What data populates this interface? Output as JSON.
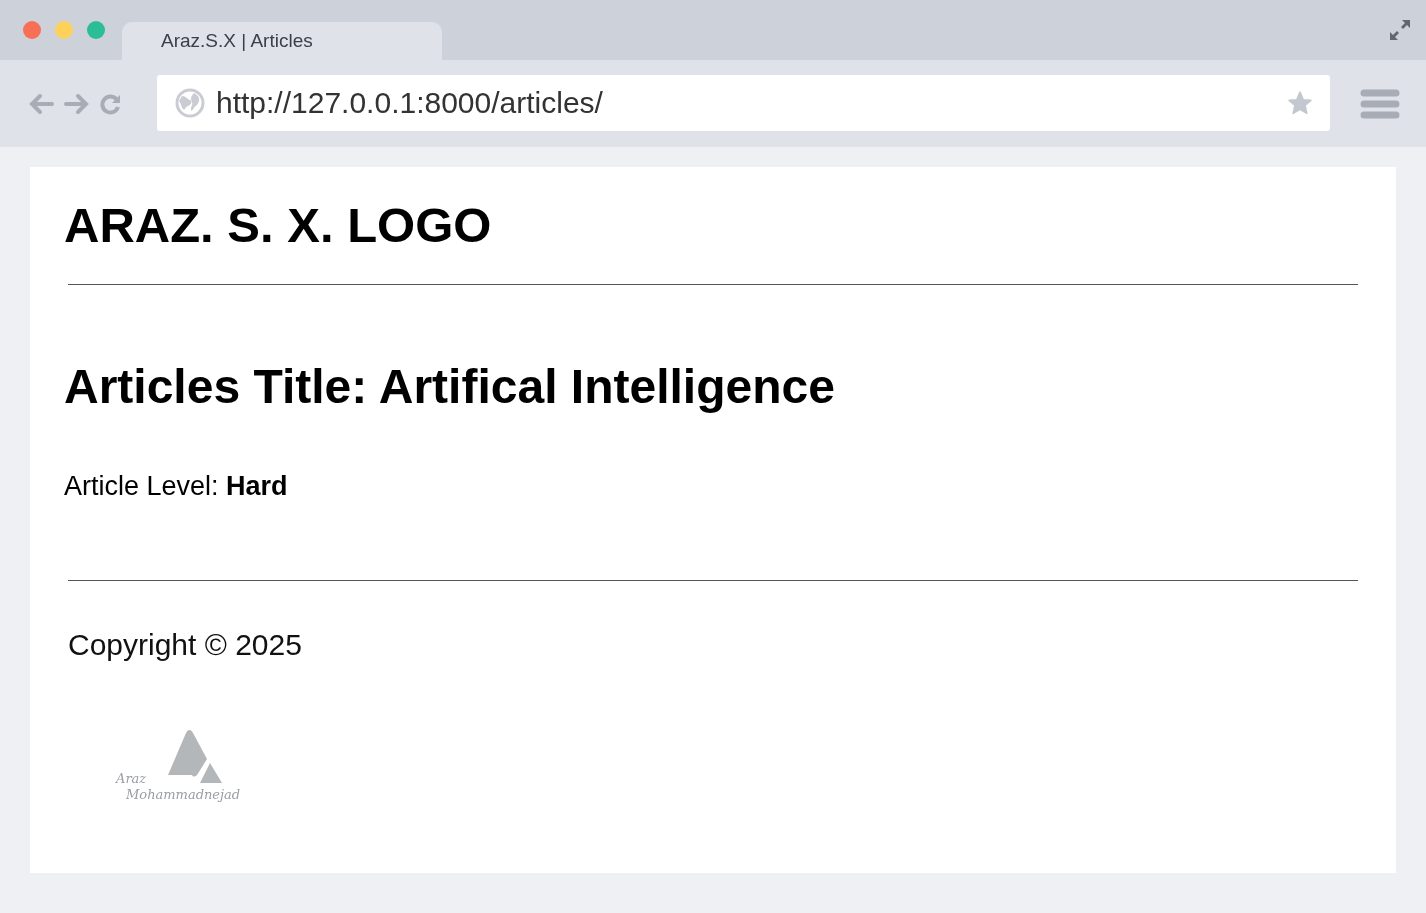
{
  "browser": {
    "tab_title": "Araz.S.X | Articles",
    "url": "http://127.0.0.1:8000/articles/"
  },
  "page": {
    "logo_text": "ARAZ. S. X. LOGO",
    "heading": "Articles Title: Artifical Intelligence",
    "level_line": "Article Level: **Hard**",
    "copyright": "Copyright © 2025",
    "footer_logo": {
      "signature": [
        "Araz",
        "Mohammadnejad"
      ]
    }
  }
}
